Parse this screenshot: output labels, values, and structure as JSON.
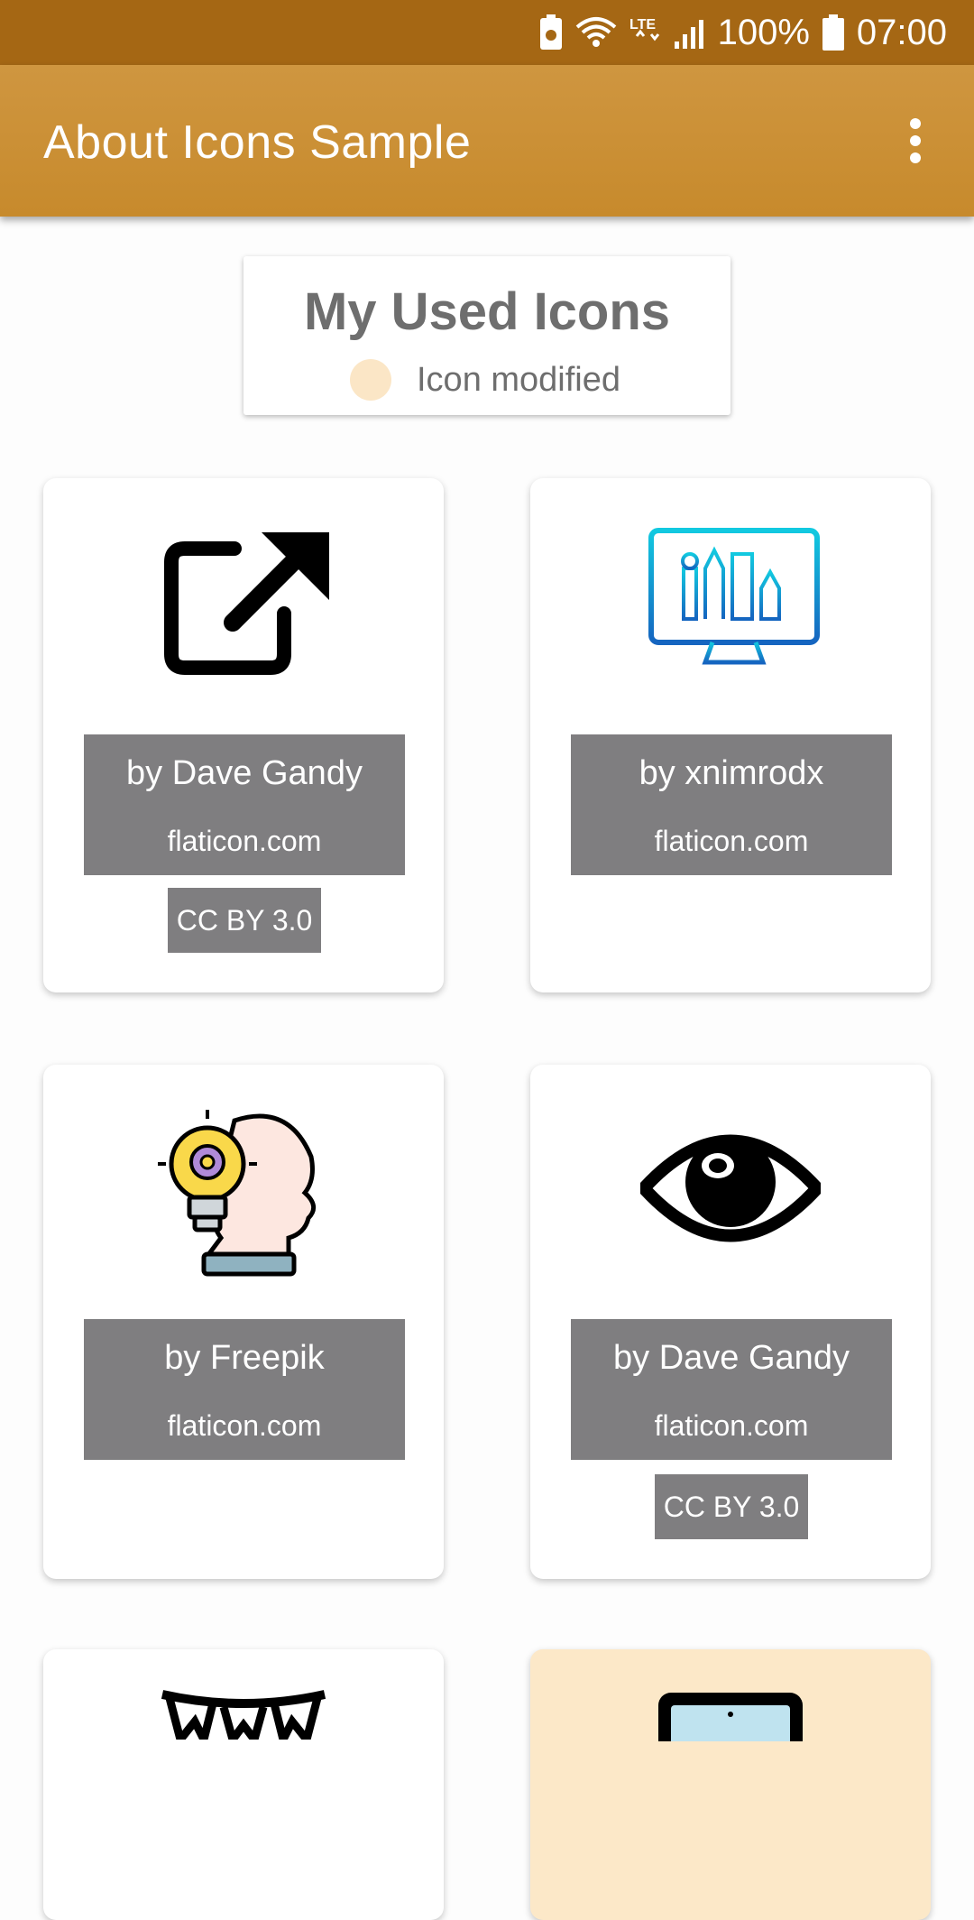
{
  "status_bar": {
    "battery_percent": "100%",
    "time": "07:00",
    "network": "LTE"
  },
  "app_bar": {
    "title": "About Icons Sample",
    "overflow_icon": "more-vert-icon"
  },
  "legend": {
    "title": "My Used Icons",
    "modified_label": "Icon modified",
    "modified_color": "#fbe6c6"
  },
  "cards": [
    {
      "icon": "external-link-icon",
      "author": "by Dave Gandy",
      "site": "flaticon.com",
      "license": "CC BY 3.0",
      "modified": false
    },
    {
      "icon": "design-monitor-icon",
      "author": "by xnimrodx",
      "site": "flaticon.com",
      "license": "",
      "modified": false
    },
    {
      "icon": "idea-head-icon",
      "author": "by Freepik",
      "site": "flaticon.com",
      "license": "",
      "modified": false
    },
    {
      "icon": "eye-icon",
      "author": "by Dave Gandy",
      "site": "flaticon.com",
      "license": "CC BY 3.0",
      "modified": false
    },
    {
      "icon": "bunting-icon",
      "modified": false
    },
    {
      "icon": "laptop-icon",
      "modified": true
    }
  ],
  "colors": {
    "status_bar": "#a56714",
    "app_bar": "#c98e33",
    "label_box": "#7f7e80"
  }
}
